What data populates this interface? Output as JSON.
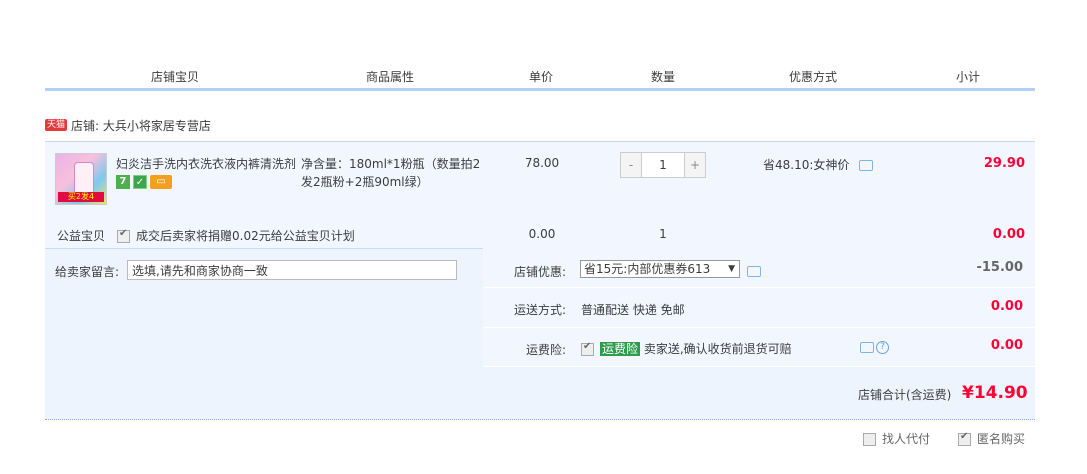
{
  "header": {
    "columns": [
      "店铺宝贝",
      "商品属性",
      "单价",
      "数量",
      "优惠方式",
      "小计"
    ]
  },
  "shop": {
    "tag": "天猫",
    "name": "店铺: 大兵小将家居专营店"
  },
  "item": {
    "title": "妇炎洁手洗内衣洗衣液内裤清洗剂",
    "attributes": "净含量：180ml*1粉瓶（数量拍2发2瓶粉+2瓶90ml绿）",
    "badge_seven": "7",
    "price": "78.00",
    "quantity": "1",
    "minus": "-",
    "plus": "+",
    "discount": "省48.10:女神价",
    "subtotal": "29.90",
    "thumb_promo": "买2发4"
  },
  "charity": {
    "label": "公益宝贝",
    "text": "成交后卖家将捐赠0.02元给公益宝贝计划",
    "price": "0.00",
    "quantity": "1",
    "subtotal": "0.00"
  },
  "message": {
    "label": "给卖家留言:",
    "placeholder": "选填,请先和商家协商一致"
  },
  "shop_discount": {
    "label": "店铺优惠:",
    "selected": "省15元:内部优惠券613",
    "amount": "-15.00"
  },
  "shipping": {
    "label": "运送方式:",
    "value": "普通配送 快递 免邮",
    "amount": "0.00"
  },
  "insurance": {
    "label": "运费险:",
    "tag": "运费险",
    "text": "卖家送,确认收货前退货可赔",
    "amount": "0.00",
    "help": "?"
  },
  "total": {
    "label": "店铺合计(含运费)",
    "amount": "¥14.90"
  },
  "bottom": {
    "pay_for_me": "找人代付",
    "anonymous": "匿名购买"
  }
}
